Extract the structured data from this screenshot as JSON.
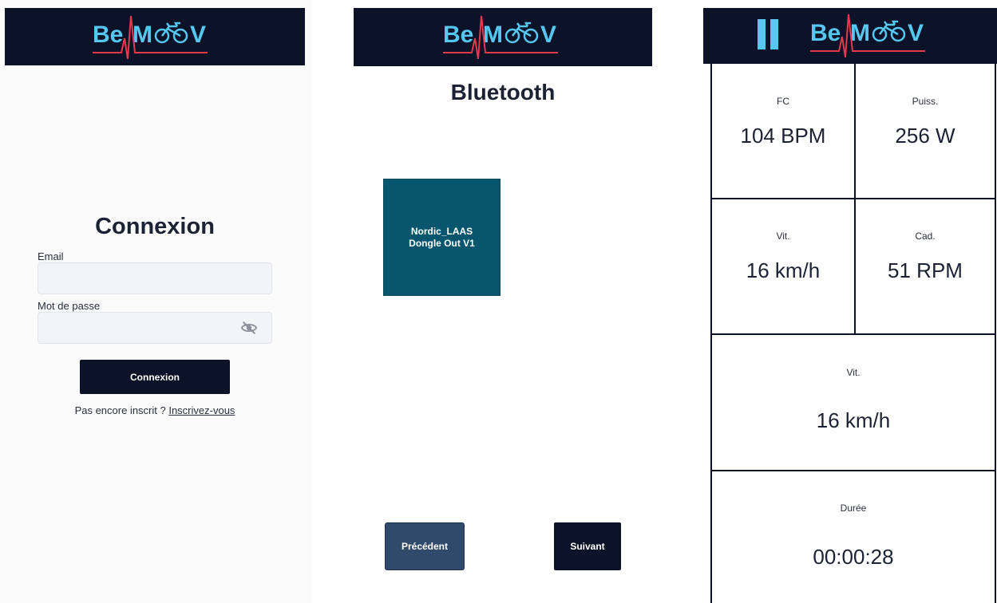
{
  "brand": {
    "logo_text_left": "Be",
    "logo_text_right": "M",
    "logo_text_end": "V",
    "text_color": "#56c7f0",
    "pulse_color": "#e2394b",
    "header_color": "#0c1228"
  },
  "login": {
    "title": "Connexion",
    "email_label": "Email",
    "email_value": "",
    "password_label": "Mot de passe",
    "password_value": "",
    "visibility_icon": "eye-off-icon",
    "submit_label": "Connexion",
    "signup_prompt": "Pas encore inscrit ? ",
    "signup_link": "Inscrivez-vous"
  },
  "bluetooth": {
    "title": "Bluetooth",
    "devices": [
      {
        "name_line1": "Nordic_LAAS",
        "name_line2": "Dongle Out V1"
      }
    ],
    "prev_label": "Précédent",
    "next_label": "Suivant"
  },
  "dashboard": {
    "pause_icon": "pause-icon",
    "metrics": {
      "heart_rate": {
        "label": "FC",
        "value": "104 BPM"
      },
      "power": {
        "label": "Puiss.",
        "value": "256 W"
      },
      "speed": {
        "label": "Vit.",
        "value": "16 km/h"
      },
      "cadence": {
        "label": "Cad.",
        "value": "51 RPM"
      },
      "speed_large": {
        "label": "Vit.",
        "value": "16 km/h"
      },
      "duration": {
        "label": "Durée",
        "value": "00:00:28"
      }
    }
  }
}
